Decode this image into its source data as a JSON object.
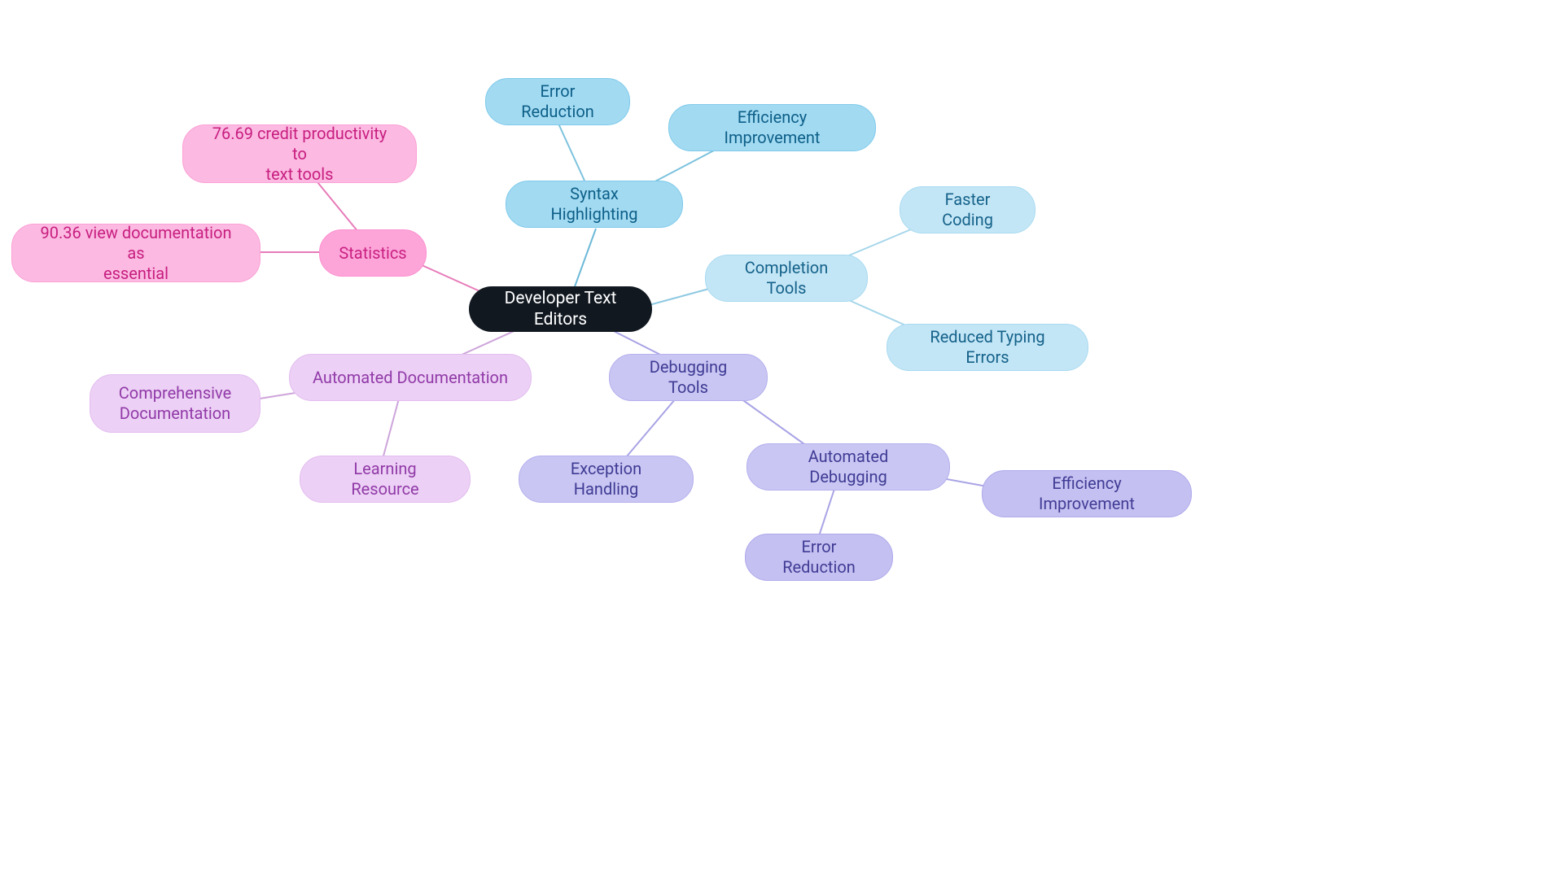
{
  "root": {
    "label": "Developer Text Editors"
  },
  "syntax": {
    "label": "Syntax Highlighting",
    "children": {
      "error": "Error Reduction",
      "efficiency": "Efficiency Improvement"
    }
  },
  "completion": {
    "label": "Completion Tools",
    "children": {
      "faster": "Faster Coding",
      "typing": "Reduced Typing Errors"
    }
  },
  "debugging": {
    "label": "Debugging Tools",
    "children": {
      "exception": "Exception Handling",
      "automated": {
        "label": "Automated Debugging",
        "children": {
          "error": "Error Reduction",
          "efficiency": "Efficiency Improvement"
        }
      }
    }
  },
  "documentation": {
    "label": "Automated Documentation",
    "children": {
      "comprehensive": "Comprehensive\nDocumentation",
      "learning": "Learning Resource"
    }
  },
  "statistics": {
    "label": "Statistics",
    "children": {
      "productivity": "76.69 credit productivity to\ntext tools",
      "essential": "90.36 view documentation as\nessential"
    }
  }
}
